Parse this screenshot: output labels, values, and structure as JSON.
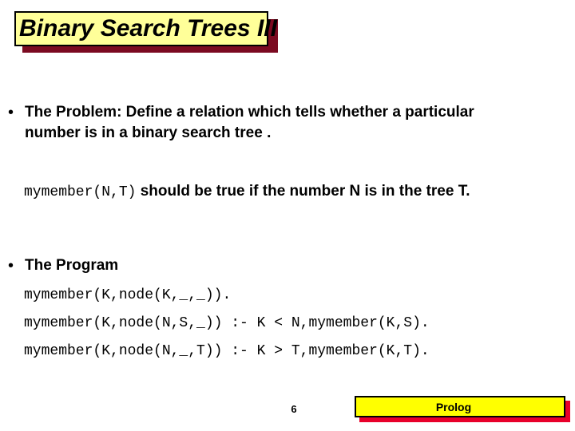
{
  "slide": {
    "title": "Binary Search Trees III",
    "title_box_color": "#FFFF99",
    "title_shadow_color": "#7B0A21",
    "background_color": "#FFFFFF"
  },
  "bullets": [
    {
      "marker": "•",
      "text": "The Problem: Define a relation which tells whether a particular number is in a binary search tree ."
    },
    {
      "marker": "•",
      "text": "The Program"
    }
  ],
  "description": {
    "code_term": "mymember(N,T)",
    "prose": " should be true if the number N is in the tree T."
  },
  "program": {
    "lines": [
      "mymember(K,node(K,_,_)).",
      "mymember(K,node(N,S,_)) :- K < N,mymember(K,S).",
      "mymember(K,node(N,_,T)) :- K > T,mymember(K,T)."
    ]
  },
  "footer": {
    "page_number": "6",
    "label": "Prolog",
    "box_color": "#FFFF00",
    "shadow_color": "#E8002A"
  }
}
